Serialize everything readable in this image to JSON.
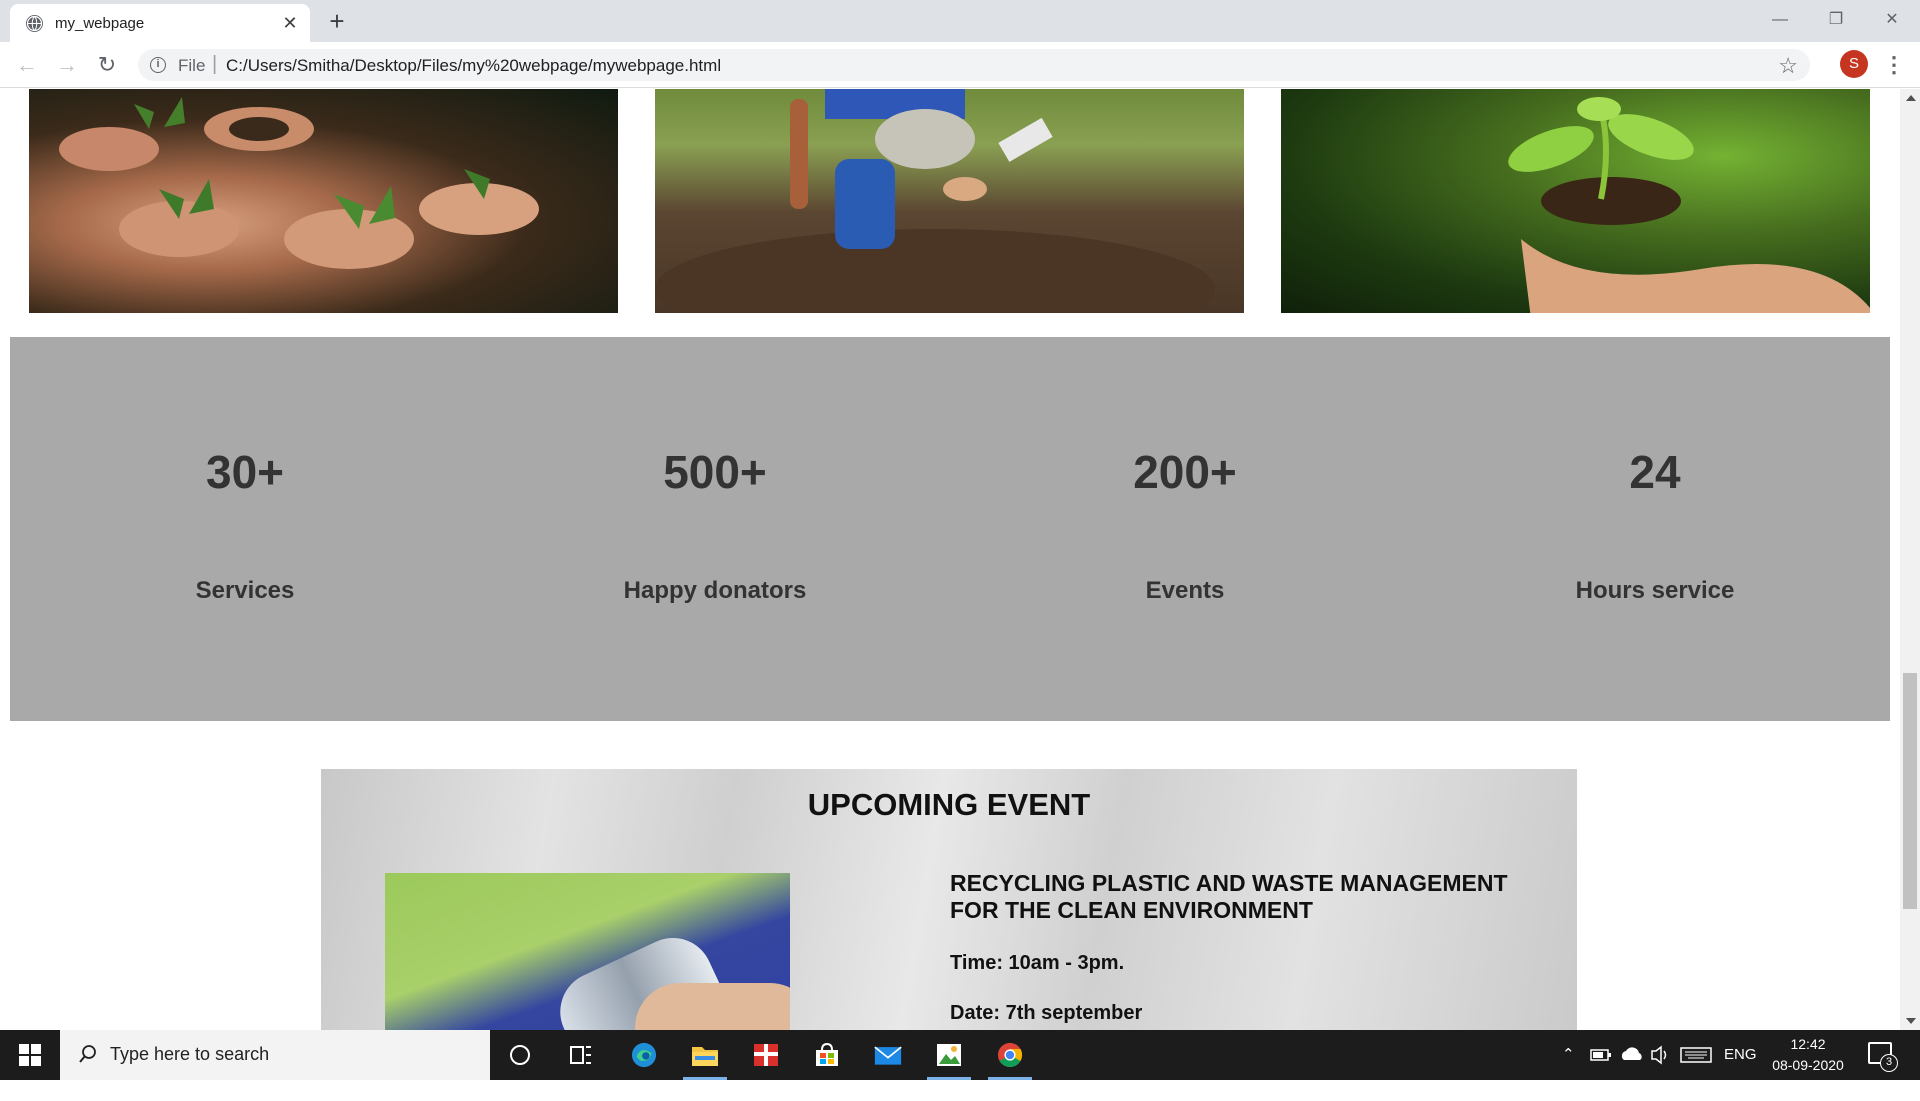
{
  "browser": {
    "tab": {
      "title": "my_webpage"
    },
    "address": {
      "scheme_label": "File",
      "url": "C:/Users/Smitha/Desktop/Files/my%20webpage/mywebpage.html"
    },
    "profile_initial": "S",
    "new_tab_icon": "plus-icon",
    "nav_icons": [
      "back-arrow-icon",
      "forward-arrow-icon",
      "reload-icon"
    ]
  },
  "page": {
    "gallery": {
      "images": [
        {
          "description": "hands-holding-seedlings"
        },
        {
          "description": "child-planting-in-soil"
        },
        {
          "description": "hands-holding-sapling"
        }
      ]
    },
    "stats": {
      "background": "#a9a9a9",
      "items": [
        {
          "number": "30+",
          "label": "Services"
        },
        {
          "number": "500+",
          "label": "Happy donators"
        },
        {
          "number": "200+",
          "label": "Events"
        },
        {
          "number": "24",
          "label": "Hours service"
        }
      ]
    },
    "event": {
      "heading": "UPCOMING EVENT",
      "title": "RECYCLING PLASTIC AND WASTE MANAGEMENT FOR THE CLEAN ENVIRONMENT",
      "time": "Time: 10am - 3pm.",
      "date": "Date: 7th september"
    }
  },
  "taskbar": {
    "search_placeholder": "Type here to search",
    "language": "ENG",
    "time": "12:42",
    "date": "08-09-2020",
    "notification_count": "3",
    "apps": [
      "edge-icon",
      "file-explorer-icon",
      "gift-app-icon",
      "store-icon",
      "mail-icon",
      "photo-app-icon",
      "chrome-icon"
    ]
  }
}
